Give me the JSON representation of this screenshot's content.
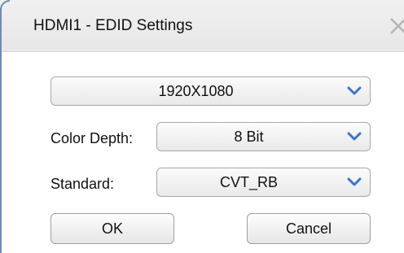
{
  "window": {
    "title": "HDMI1 - EDID Settings",
    "close_icon": "close-icon"
  },
  "resolution": {
    "value": "1920X1080"
  },
  "color_depth": {
    "label": "Color Depth:",
    "value": "8 Bit"
  },
  "standard": {
    "label": "Standard:",
    "value": "CVT_RB"
  },
  "buttons": {
    "ok": "OK",
    "cancel": "Cancel"
  },
  "colors": {
    "arrow": "#3d74c8",
    "accent_edge": "#6e8bb8"
  },
  "icons": {
    "dropdown": "chevron-down-icon"
  }
}
